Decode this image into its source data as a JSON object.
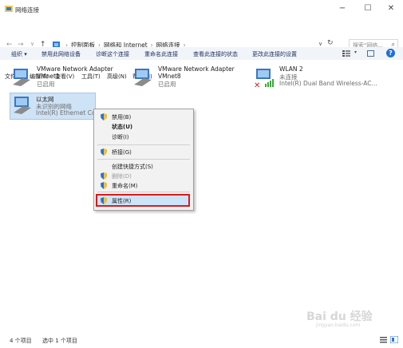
{
  "window": {
    "title": "网络连接",
    "minimize_glyph": "−",
    "maximize_glyph": "☐",
    "close_glyph": "✕"
  },
  "address": {
    "back_glyph": "←",
    "forward_glyph": "→",
    "up_glyph": "↑",
    "crumbs": [
      "控制面板",
      "网络和 Internet",
      "网络连接"
    ],
    "separator": "›",
    "search_placeholder": "搜索\"网络...",
    "search_glyph": "⌕",
    "refresh_glyph": "↻",
    "chevron_glyph": "∨"
  },
  "menubar": [
    "文件(F)",
    "编辑(E)",
    "查看(V)",
    "工具(T)",
    "高级(N)",
    "帮助(H)"
  ],
  "commandbar": {
    "organize": "组织 ▾",
    "items": [
      "禁用此网络设备",
      "诊断这个连接",
      "重命名此连接",
      "查看此连接的状态",
      "更改此连接的设置"
    ],
    "help_glyph": "?"
  },
  "adapters": [
    {
      "name": "VMware Network Adapter",
      "line2": "VMnet1",
      "line3": "已启用"
    },
    {
      "name": "VMware Network Adapter",
      "line2": "VMnet8",
      "line3": "已启用"
    },
    {
      "name": "WLAN 2",
      "line2": "未连接",
      "line3": "Intel(R) Dual Band Wireless-AC..."
    },
    {
      "name": "以太网",
      "line2": "未识别的网络",
      "line3": "Intel(R) Ethernet Con"
    }
  ],
  "context_menu": {
    "items": [
      {
        "label": "禁用(B)",
        "shield": true,
        "bold": false,
        "disabled": false
      },
      {
        "label": "状态(U)",
        "shield": false,
        "bold": true,
        "disabled": false
      },
      {
        "label": "诊断(I)",
        "shield": false,
        "bold": false,
        "disabled": false
      },
      {
        "label": "桥接(G)",
        "shield": true,
        "bold": false,
        "disabled": false
      },
      {
        "label": "创建快捷方式(S)",
        "shield": false,
        "bold": false,
        "disabled": false
      },
      {
        "label": "删除(D)",
        "shield": true,
        "bold": false,
        "disabled": true
      },
      {
        "label": "重命名(M)",
        "shield": true,
        "bold": false,
        "disabled": false
      },
      {
        "label": "属性(R)",
        "shield": true,
        "bold": false,
        "disabled": false,
        "highlighted": true
      }
    ]
  },
  "statusbar": {
    "count": "4 个项目",
    "selected": "选中 1 个项目"
  },
  "watermark": {
    "brand": "Bai du 经验",
    "url": "jingyan.baidu.com"
  },
  "colors": {
    "accent": "#1e6fd9",
    "selection": "#cfe3f6",
    "highlight_border": "#e01818"
  }
}
